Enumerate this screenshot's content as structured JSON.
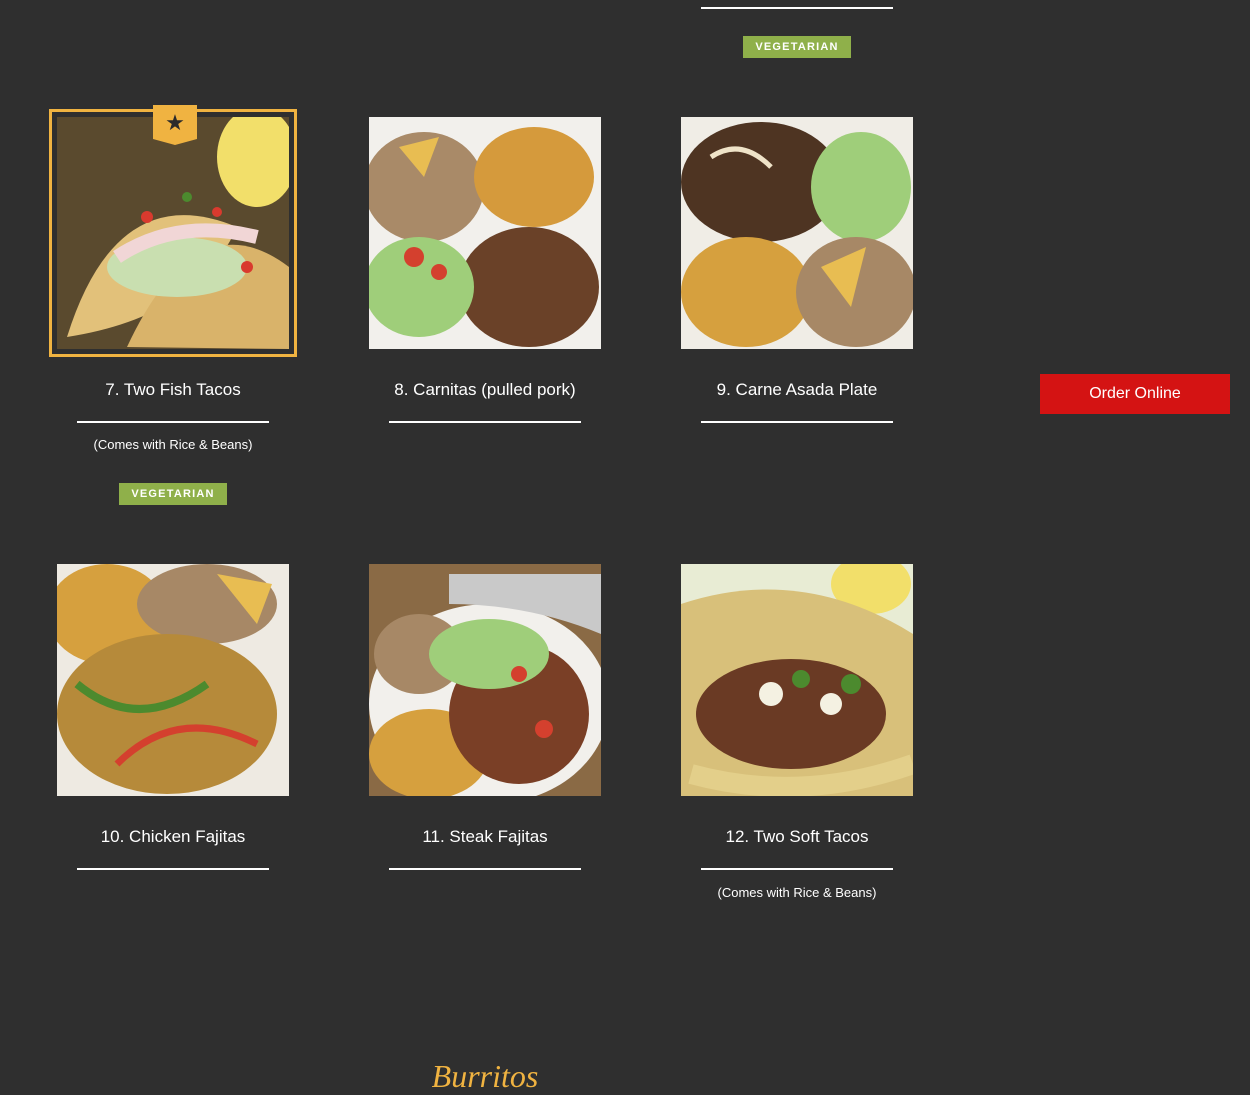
{
  "top_item": {
    "badge": "VEGETARIAN"
  },
  "menu_items": [
    {
      "title": "7. Two Fish Tacos",
      "subtitle": "(Comes with Rice & Beans)",
      "badge": "VEGETARIAN",
      "featured": true,
      "featured_icon": "star-icon"
    },
    {
      "title": "8. Carnitas (pulled pork)"
    },
    {
      "title": "9. Carne Asada Plate"
    },
    {
      "title": "10. Chicken Fajitas"
    },
    {
      "title": "11. Steak Fajitas"
    },
    {
      "title": "12. Two Soft Tacos",
      "subtitle": "(Comes with Rice & Beans)"
    }
  ],
  "order_button": {
    "label": "Order Online"
  },
  "next_section": {
    "title": "Burritos"
  },
  "colors": {
    "background": "#2f2f2f",
    "accent": "#f0b341",
    "badge": "#8fb04a",
    "order_button": "#d41313"
  },
  "star_glyph": "★"
}
